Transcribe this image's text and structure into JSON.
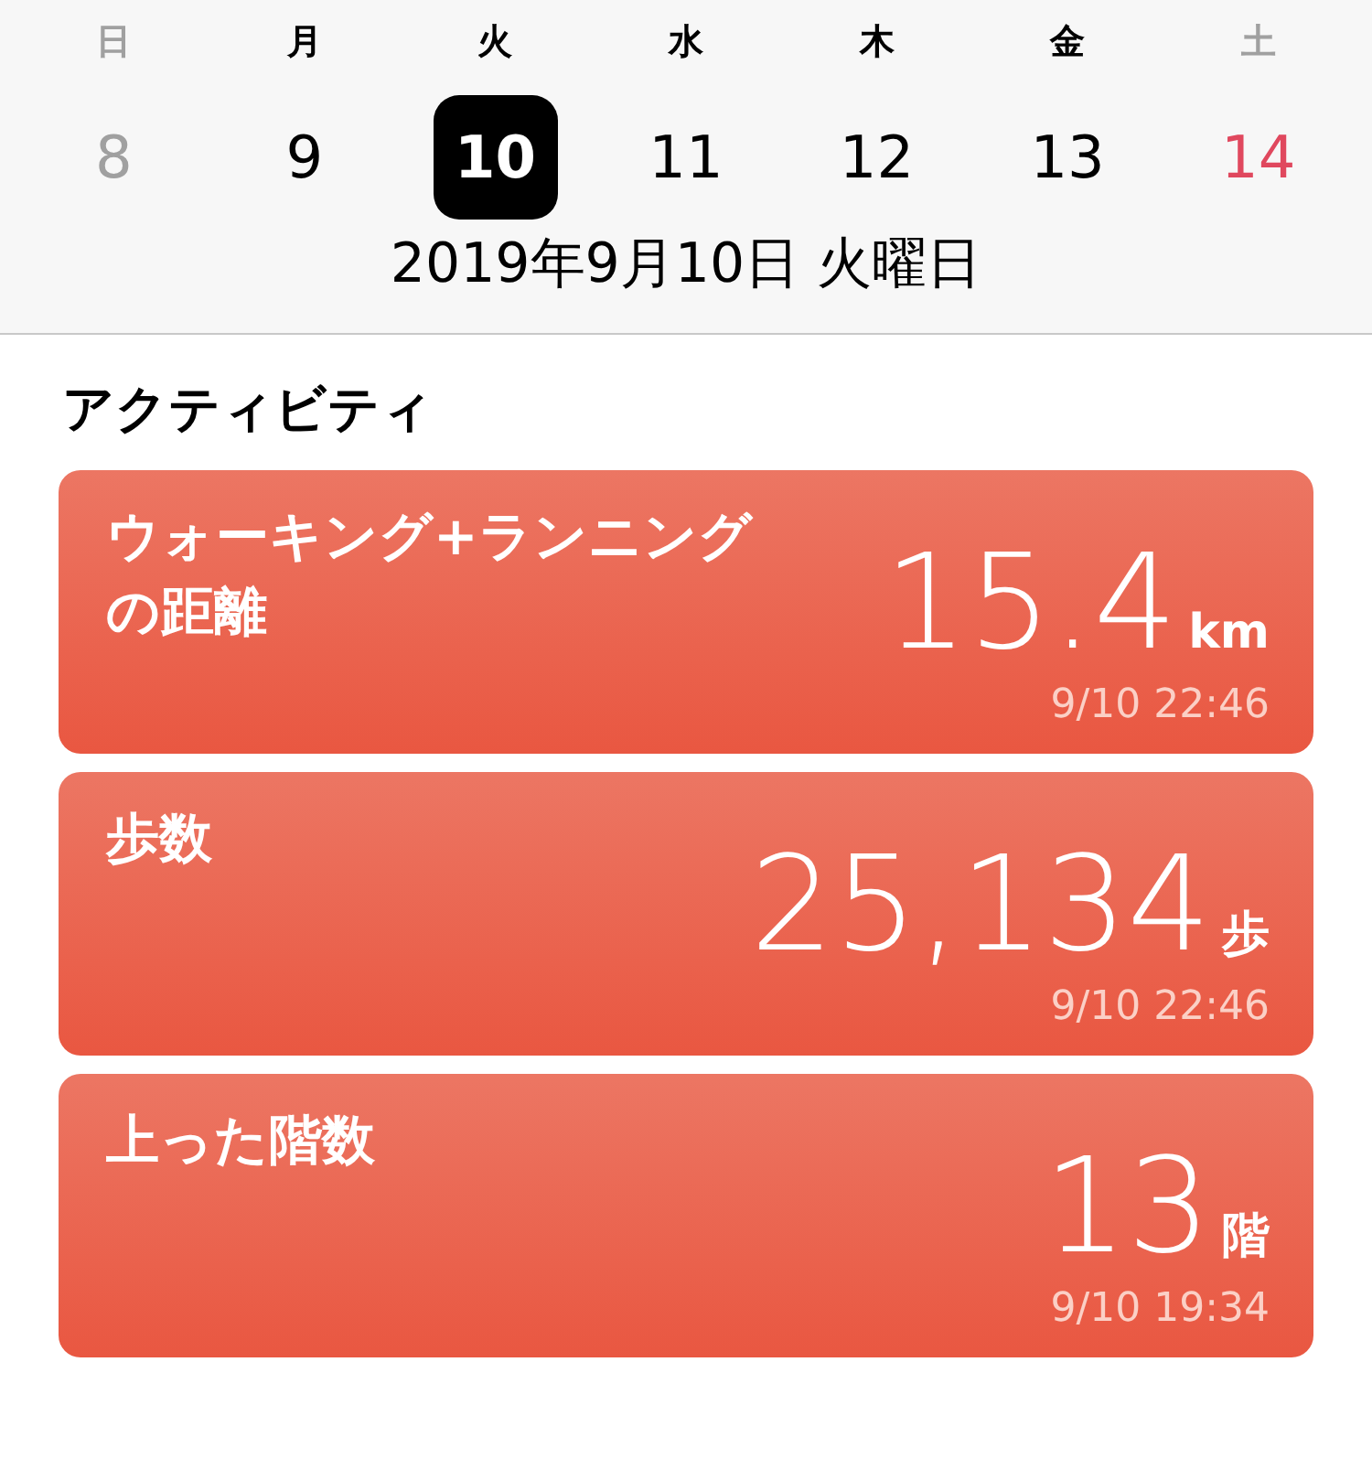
{
  "week": [
    {
      "weekday": "日",
      "day": "8",
      "kind": "sunday",
      "selected": false
    },
    {
      "weekday": "月",
      "day": "9",
      "kind": "weekday",
      "selected": false
    },
    {
      "weekday": "火",
      "day": "10",
      "kind": "weekday",
      "selected": true
    },
    {
      "weekday": "水",
      "day": "11",
      "kind": "weekday",
      "selected": false
    },
    {
      "weekday": "木",
      "day": "12",
      "kind": "weekday",
      "selected": false
    },
    {
      "weekday": "金",
      "day": "13",
      "kind": "weekday",
      "selected": false
    },
    {
      "weekday": "土",
      "day": "14",
      "kind": "saturday",
      "selected": false
    }
  ],
  "date_label": "2019年9月10日 火曜日",
  "section_title": "アクティビティ",
  "cards": [
    {
      "title": "ウォーキング+ランニングの距離",
      "value": "15.4",
      "unit": "km",
      "time": "9/10 22:46"
    },
    {
      "title": "歩数",
      "value": "25,134",
      "unit": "歩",
      "time": "9/10 22:46"
    },
    {
      "title": "上った階数",
      "value": "13",
      "unit": "階",
      "time": "9/10 19:34"
    }
  ]
}
